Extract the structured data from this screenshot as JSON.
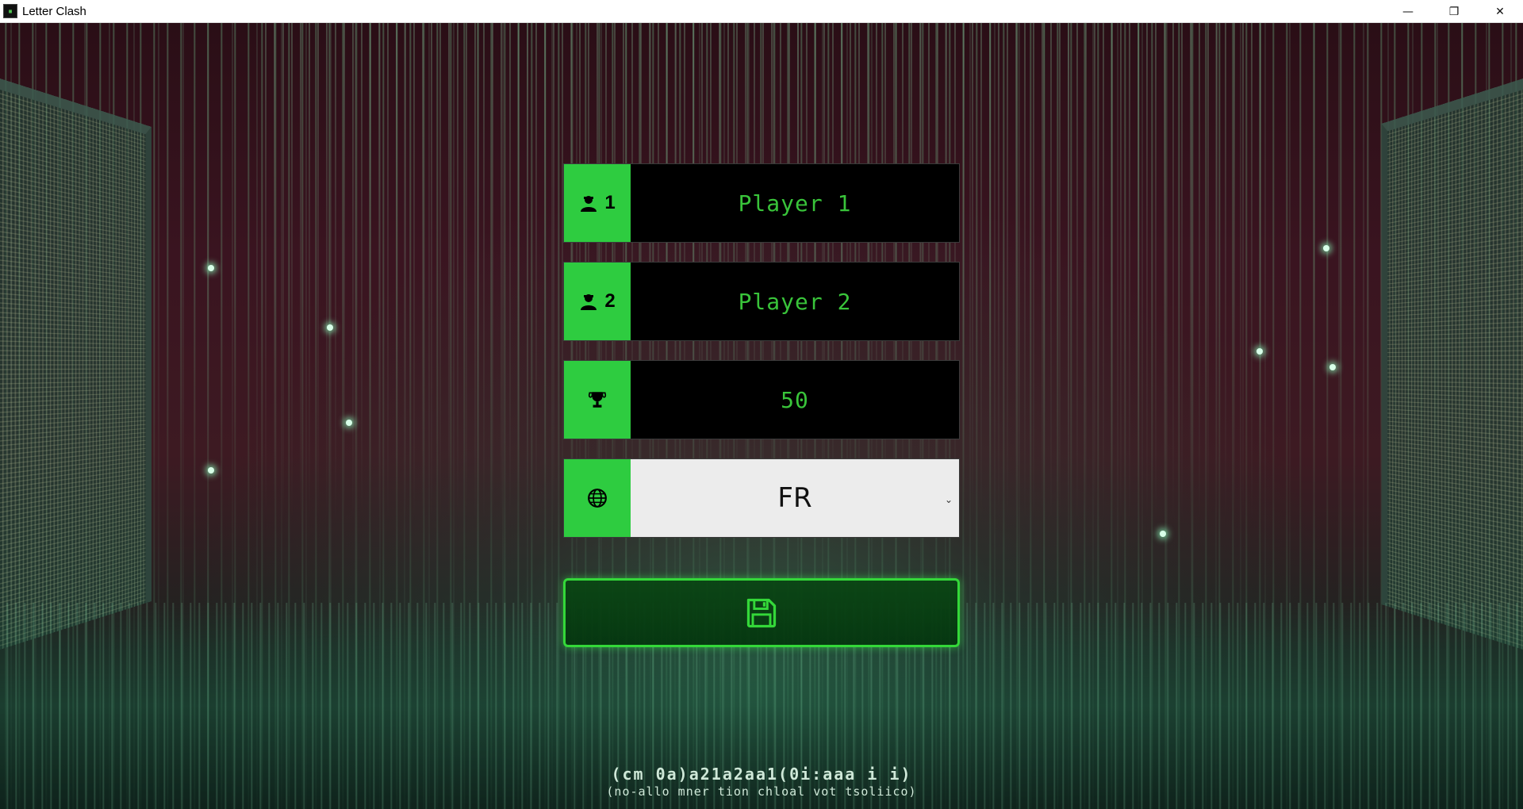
{
  "window": {
    "title": "Letter Clash",
    "controls": {
      "minimize": "—",
      "maximize": "❐",
      "close": "✕"
    }
  },
  "form": {
    "player1": {
      "number": "1",
      "value": "Player 1",
      "icon": "user-icon"
    },
    "player2": {
      "number": "2",
      "value": "Player 2",
      "icon": "user-icon"
    },
    "target_score": {
      "value": "50",
      "icon": "trophy-icon"
    },
    "language": {
      "selected": "FR",
      "icon": "globe-icon",
      "chevron": "⌄"
    },
    "save": {
      "icon": "floppy-disk-icon"
    }
  },
  "background": {
    "footer_line1": "(cm 0a)a21a2aa1(0i:aaa  i i)",
    "footer_line2": "(no-allo mner tion chloal vot tsoliico)"
  },
  "colors": {
    "accent_green": "#2ecc40",
    "field_text_green": "#39c43a",
    "button_border": "#34d839"
  }
}
